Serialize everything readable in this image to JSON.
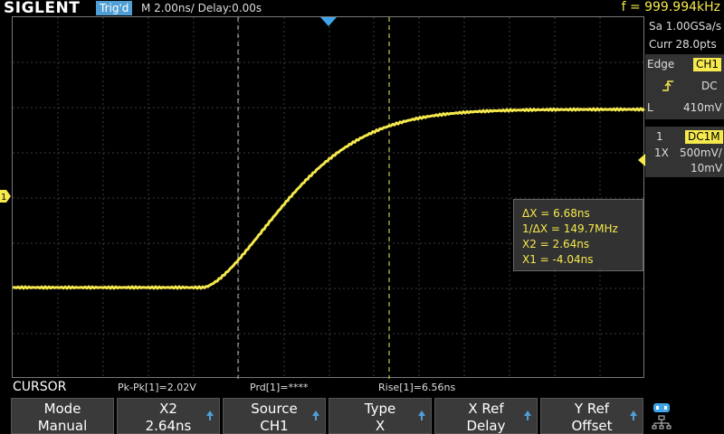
{
  "header": {
    "logo": "SIGLENT",
    "trig_status": "Trig'd",
    "timebase": "M 2.00ns/  Delay:0.00s",
    "frequency": "f = 999.994kHz"
  },
  "right_panel": {
    "sample_rate": "Sa 1.00GSa/s",
    "curr_pts": "Curr 28.0pts",
    "trigger_type": "Edge",
    "trigger_source": "CH1",
    "trigger_coupling": "DC",
    "trigger_level_label": "L",
    "trigger_level": "410mV",
    "channel_number": "1",
    "channel_coupling": "DC1M",
    "probe": "1X",
    "volts_per_div": "500mV/",
    "offset": "10mV"
  },
  "cursor_info": {
    "delta_x": "ΔX = 6.68ns",
    "inv_delta_x": "1/ΔX = 149.7MHz",
    "x2": "X2 = 2.64ns",
    "x1": "X1 = -4.04ns"
  },
  "measurements": {
    "menu_title": "CURSOR",
    "pk_pk": "Pk-Pk[1]=2.02V",
    "prd": "Prd[1]=****",
    "rise": "Rise[1]=6.56ns"
  },
  "softkeys": [
    {
      "label": "Mode",
      "value": "Manual",
      "arrow": false
    },
    {
      "label": "X2",
      "value": "2.64ns",
      "arrow": true
    },
    {
      "label": "Source",
      "value": "CH1",
      "arrow": true
    },
    {
      "label": "Type",
      "value": "X",
      "arrow": true
    },
    {
      "label": "X Ref",
      "value": "Delay",
      "arrow": true
    },
    {
      "label": "Y Ref",
      "value": "Offset",
      "arrow": true
    }
  ],
  "channel_marker": "1",
  "colors": {
    "trace": "#f5e94d",
    "trig_badge": "#4f9fd6",
    "grid": "#3a3a3a"
  }
}
